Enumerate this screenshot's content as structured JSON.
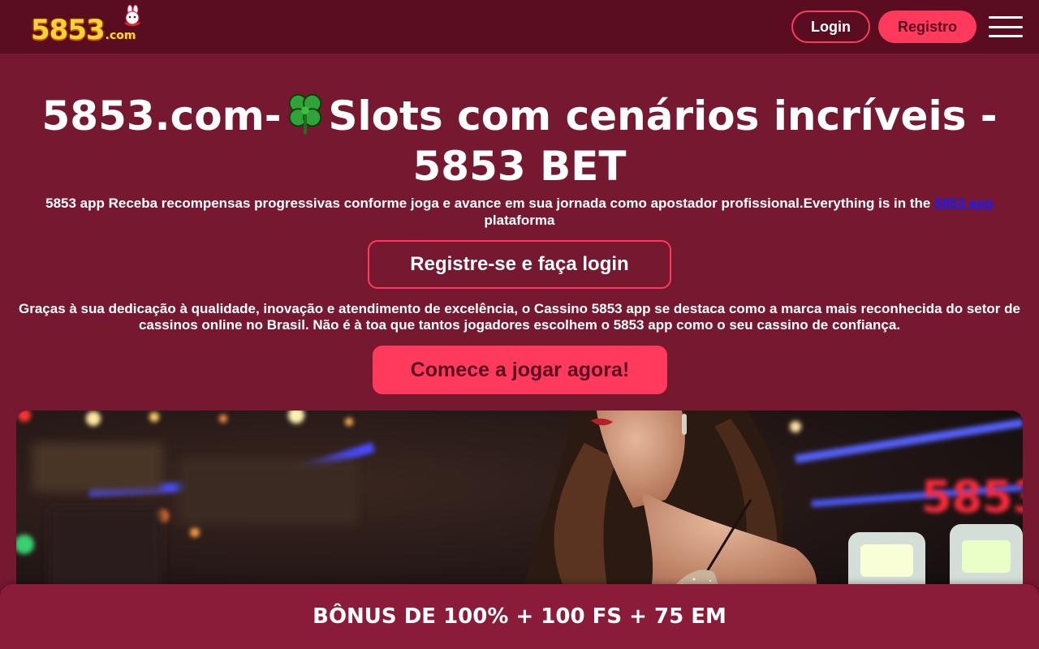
{
  "header": {
    "logo_number": "5853",
    "logo_domain": ".com",
    "login_label": "Login",
    "register_label": "Registro"
  },
  "hero_title": {
    "part1": "5853.com-",
    "part2": "Slots com cenários incríveis - 5853 BET"
  },
  "intro": {
    "text": "5853 app Receba recompensas progressivas conforme joga e avance em sua jornada como apostador profissional.Everything is in the ",
    "link_text": "5853 app",
    "text_after": " plataforma"
  },
  "register_login_button": "Registre-se e faça login",
  "description": "Graças à sua dedicação à qualidade, inovação e atendimento de excelência, o Cassino 5853 app se destaca como a marca mais reconhecida do setor de cassinos online no Brasil. Não é à toa que tantos jogadores escolhem o 5853 app como o seu cassino de confiança.",
  "play_button": "Comece a jogar agora!",
  "bonus_bar": "BÔNUS DE 100% + 100 FS + 75 EM",
  "colors": {
    "background": "#761830",
    "header": "#5a0d20",
    "accent": "#ff3a5c",
    "bonus_bar": "#8a1c3a"
  },
  "icons": [
    "clover-icon",
    "menu-icon",
    "logo-mascot"
  ]
}
